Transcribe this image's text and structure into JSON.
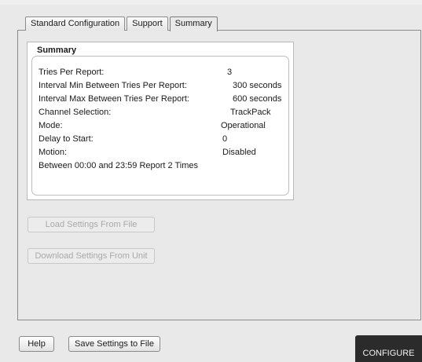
{
  "tabs": [
    "Standard Configuration",
    "Support",
    "Summary"
  ],
  "summary": {
    "title": "Summary",
    "rows": [
      {
        "label": "Tries Per Report:",
        "value": "3"
      },
      {
        "label": "Interval Min Between Tries Per Report:",
        "value": "300 seconds"
      },
      {
        "label": "Interval Max Between Tries Per Report:",
        "value": "600 seconds"
      },
      {
        "label": "Channel Selection:",
        "value": "TrackPack"
      },
      {
        "label": "Mode:",
        "value": "Operational"
      },
      {
        "label": "Delay to Start:",
        "value": "0"
      },
      {
        "label": "Motion:",
        "value": "Disabled"
      },
      {
        "label": "Between 00:00 and 23:59 Report 2 Times",
        "value": ""
      }
    ]
  },
  "actions": {
    "load_label": "Load Settings From File",
    "download_label": "Download Settings From Unit"
  },
  "footer": {
    "help_label": "Help",
    "save_label": "Save Settings to File",
    "configure_label": "CONFIGURE"
  },
  "colors": {
    "background": "#e9e9e9",
    "configure_button": "#2b2b2b",
    "disabled_text": "#a8a8a8"
  }
}
